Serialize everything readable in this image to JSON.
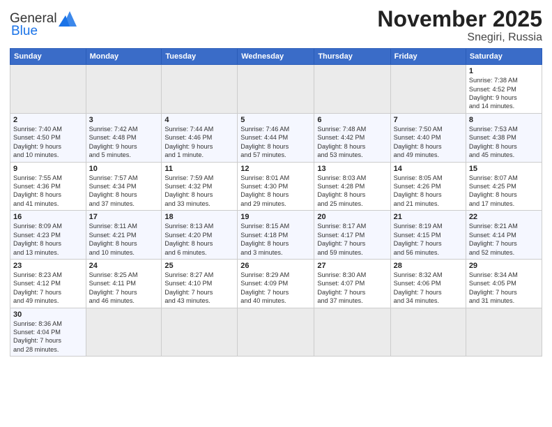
{
  "header": {
    "logo_general": "General",
    "logo_blue": "Blue",
    "title": "November 2025",
    "subtitle": "Snegiri, Russia"
  },
  "weekdays": [
    "Sunday",
    "Monday",
    "Tuesday",
    "Wednesday",
    "Thursday",
    "Friday",
    "Saturday"
  ],
  "weeks": [
    [
      {
        "day": "",
        "info": "",
        "empty": true
      },
      {
        "day": "",
        "info": "",
        "empty": true
      },
      {
        "day": "",
        "info": "",
        "empty": true
      },
      {
        "day": "",
        "info": "",
        "empty": true
      },
      {
        "day": "",
        "info": "",
        "empty": true
      },
      {
        "day": "",
        "info": "",
        "empty": true
      },
      {
        "day": "1",
        "info": "Sunrise: 7:38 AM\nSunset: 4:52 PM\nDaylight: 9 hours\nand 14 minutes."
      }
    ],
    [
      {
        "day": "2",
        "info": "Sunrise: 7:40 AM\nSunset: 4:50 PM\nDaylight: 9 hours\nand 10 minutes."
      },
      {
        "day": "3",
        "info": "Sunrise: 7:42 AM\nSunset: 4:48 PM\nDaylight: 9 hours\nand 5 minutes."
      },
      {
        "day": "4",
        "info": "Sunrise: 7:44 AM\nSunset: 4:46 PM\nDaylight: 9 hours\nand 1 minute."
      },
      {
        "day": "5",
        "info": "Sunrise: 7:46 AM\nSunset: 4:44 PM\nDaylight: 8 hours\nand 57 minutes."
      },
      {
        "day": "6",
        "info": "Sunrise: 7:48 AM\nSunset: 4:42 PM\nDaylight: 8 hours\nand 53 minutes."
      },
      {
        "day": "7",
        "info": "Sunrise: 7:50 AM\nSunset: 4:40 PM\nDaylight: 8 hours\nand 49 minutes."
      },
      {
        "day": "8",
        "info": "Sunrise: 7:53 AM\nSunset: 4:38 PM\nDaylight: 8 hours\nand 45 minutes."
      }
    ],
    [
      {
        "day": "9",
        "info": "Sunrise: 7:55 AM\nSunset: 4:36 PM\nDaylight: 8 hours\nand 41 minutes."
      },
      {
        "day": "10",
        "info": "Sunrise: 7:57 AM\nSunset: 4:34 PM\nDaylight: 8 hours\nand 37 minutes."
      },
      {
        "day": "11",
        "info": "Sunrise: 7:59 AM\nSunset: 4:32 PM\nDaylight: 8 hours\nand 33 minutes."
      },
      {
        "day": "12",
        "info": "Sunrise: 8:01 AM\nSunset: 4:30 PM\nDaylight: 8 hours\nand 29 minutes."
      },
      {
        "day": "13",
        "info": "Sunrise: 8:03 AM\nSunset: 4:28 PM\nDaylight: 8 hours\nand 25 minutes."
      },
      {
        "day": "14",
        "info": "Sunrise: 8:05 AM\nSunset: 4:26 PM\nDaylight: 8 hours\nand 21 minutes."
      },
      {
        "day": "15",
        "info": "Sunrise: 8:07 AM\nSunset: 4:25 PM\nDaylight: 8 hours\nand 17 minutes."
      }
    ],
    [
      {
        "day": "16",
        "info": "Sunrise: 8:09 AM\nSunset: 4:23 PM\nDaylight: 8 hours\nand 13 minutes."
      },
      {
        "day": "17",
        "info": "Sunrise: 8:11 AM\nSunset: 4:21 PM\nDaylight: 8 hours\nand 10 minutes."
      },
      {
        "day": "18",
        "info": "Sunrise: 8:13 AM\nSunset: 4:20 PM\nDaylight: 8 hours\nand 6 minutes."
      },
      {
        "day": "19",
        "info": "Sunrise: 8:15 AM\nSunset: 4:18 PM\nDaylight: 8 hours\nand 3 minutes."
      },
      {
        "day": "20",
        "info": "Sunrise: 8:17 AM\nSunset: 4:17 PM\nDaylight: 7 hours\nand 59 minutes."
      },
      {
        "day": "21",
        "info": "Sunrise: 8:19 AM\nSunset: 4:15 PM\nDaylight: 7 hours\nand 56 minutes."
      },
      {
        "day": "22",
        "info": "Sunrise: 8:21 AM\nSunset: 4:14 PM\nDaylight: 7 hours\nand 52 minutes."
      }
    ],
    [
      {
        "day": "23",
        "info": "Sunrise: 8:23 AM\nSunset: 4:12 PM\nDaylight: 7 hours\nand 49 minutes."
      },
      {
        "day": "24",
        "info": "Sunrise: 8:25 AM\nSunset: 4:11 PM\nDaylight: 7 hours\nand 46 minutes."
      },
      {
        "day": "25",
        "info": "Sunrise: 8:27 AM\nSunset: 4:10 PM\nDaylight: 7 hours\nand 43 minutes."
      },
      {
        "day": "26",
        "info": "Sunrise: 8:29 AM\nSunset: 4:09 PM\nDaylight: 7 hours\nand 40 minutes."
      },
      {
        "day": "27",
        "info": "Sunrise: 8:30 AM\nSunset: 4:07 PM\nDaylight: 7 hours\nand 37 minutes."
      },
      {
        "day": "28",
        "info": "Sunrise: 8:32 AM\nSunset: 4:06 PM\nDaylight: 7 hours\nand 34 minutes."
      },
      {
        "day": "29",
        "info": "Sunrise: 8:34 AM\nSunset: 4:05 PM\nDaylight: 7 hours\nand 31 minutes."
      }
    ],
    [
      {
        "day": "30",
        "info": "Sunrise: 8:36 AM\nSunset: 4:04 PM\nDaylight: 7 hours\nand 28 minutes."
      },
      {
        "day": "",
        "info": "",
        "empty": true
      },
      {
        "day": "",
        "info": "",
        "empty": true
      },
      {
        "day": "",
        "info": "",
        "empty": true
      },
      {
        "day": "",
        "info": "",
        "empty": true
      },
      {
        "day": "",
        "info": "",
        "empty": true
      },
      {
        "day": "",
        "info": "",
        "empty": true
      }
    ]
  ]
}
